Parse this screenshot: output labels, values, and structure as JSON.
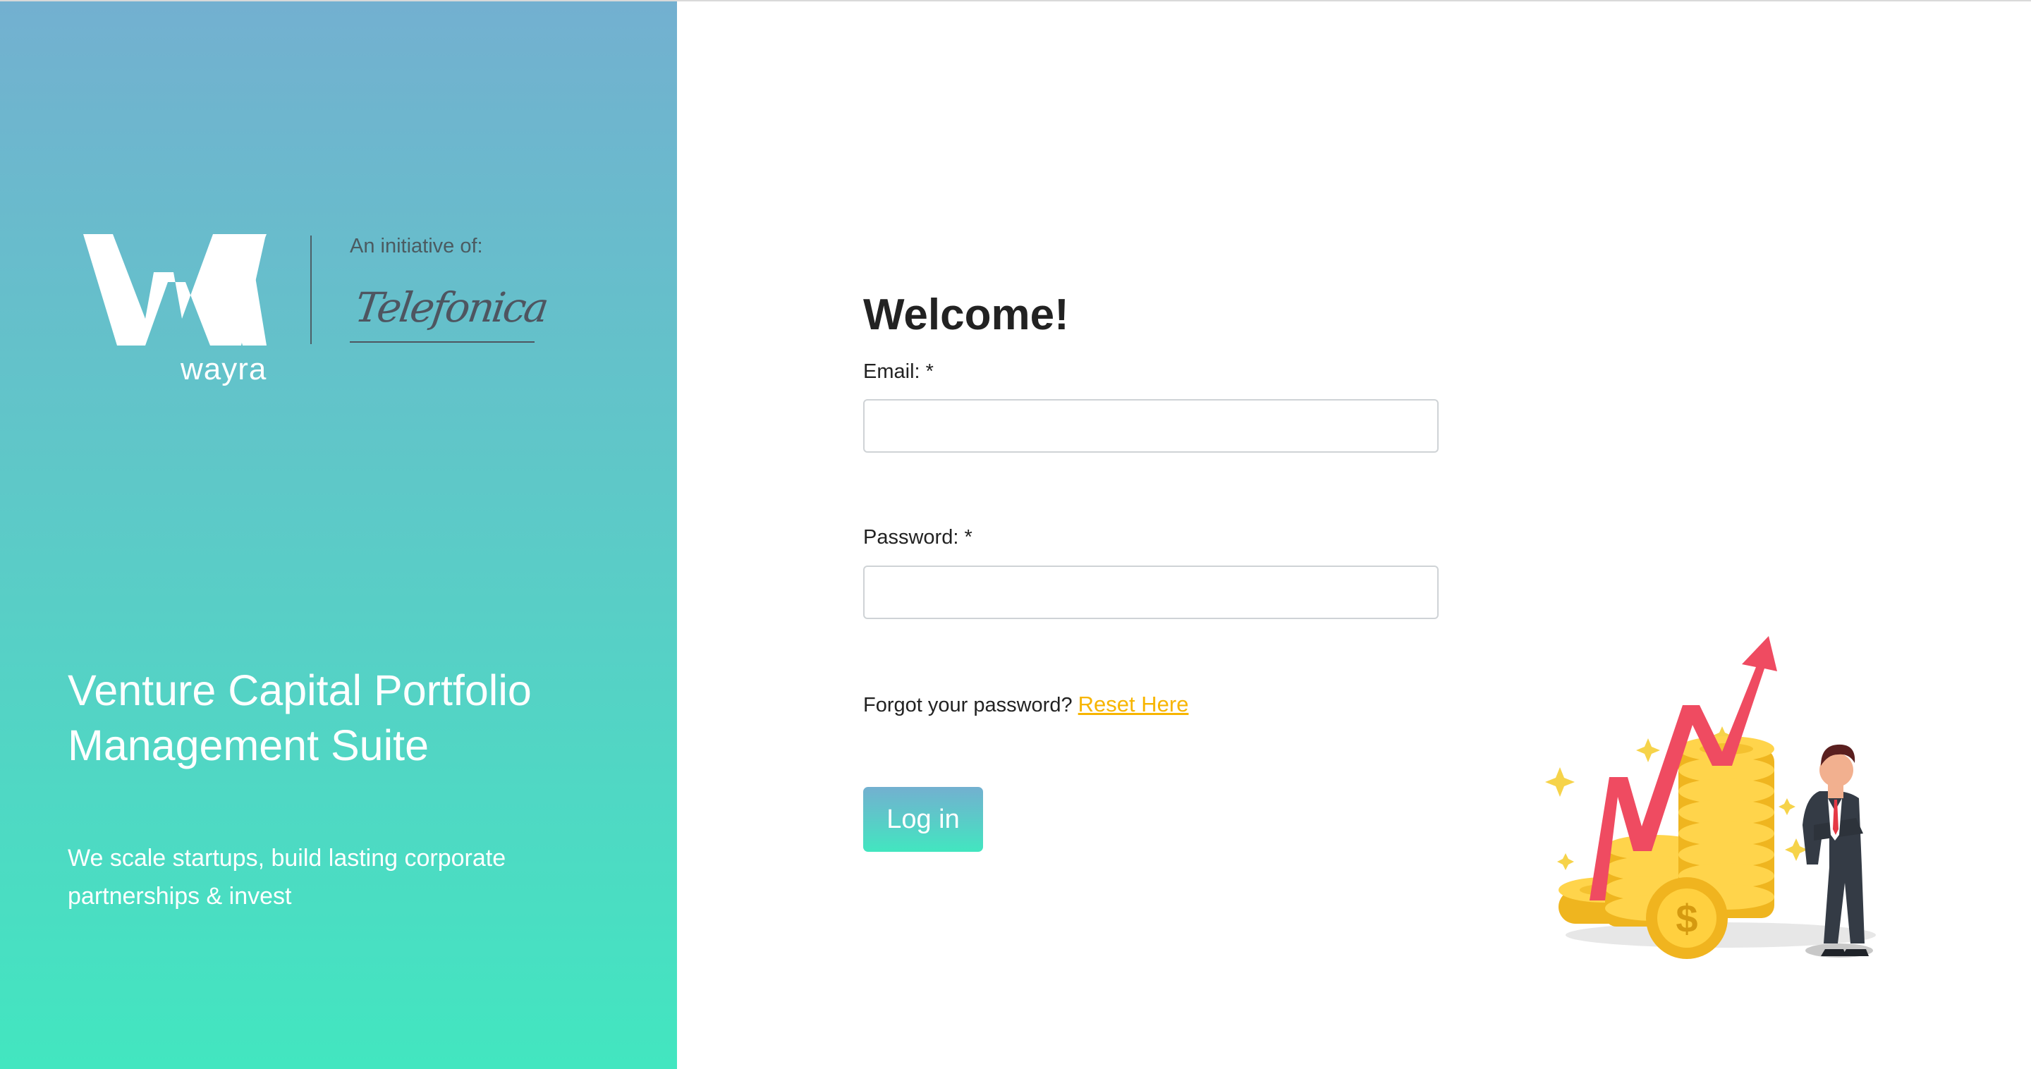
{
  "brand": {
    "wordmark": "wayra",
    "initiative_label": "An initiative of:",
    "partner_name": "Telefonica"
  },
  "left_panel": {
    "title": "Venture Capital Portfolio Management Suite",
    "subtitle": "We scale startups, build lasting corporate partnerships & invest",
    "gradient_top": "#73b0d0",
    "gradient_bottom": "#42e6c0"
  },
  "form": {
    "heading": "Welcome!",
    "email_label": "Email: *",
    "email_value": "",
    "password_label": "Password: *",
    "password_value": "",
    "forgot_text": "Forgot your password?",
    "reset_link": "Reset Here",
    "login_button": "Log in"
  },
  "colors": {
    "accent_link": "#f7b500",
    "text": "#222222",
    "input_border": "#cfd3d6"
  },
  "icons": {
    "brand_mark": "wayra-w-icon",
    "illustration": "investment-growth-illustration"
  }
}
